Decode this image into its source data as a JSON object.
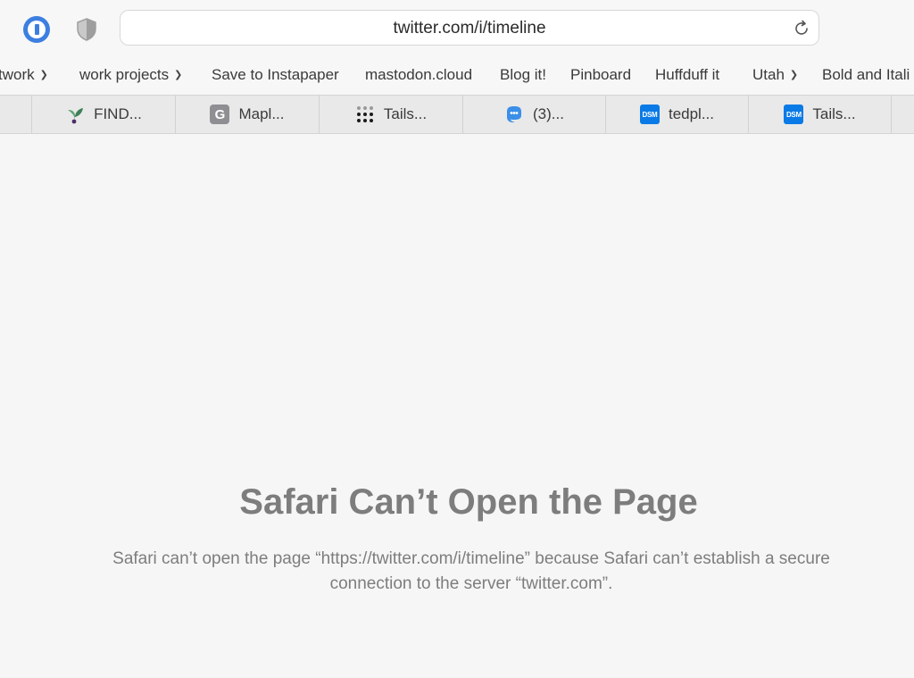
{
  "browser": {
    "url": "twitter.com/i/timeline",
    "extensions": [
      "1password-icon",
      "shield-icon"
    ]
  },
  "bookmarks": [
    {
      "label": "twork",
      "folder": true
    },
    {
      "label": "work projects",
      "folder": true
    },
    {
      "label": "Save to Instapaper",
      "folder": false
    },
    {
      "label": "mastodon.cloud",
      "folder": false
    },
    {
      "label": "Blog it!",
      "folder": false
    },
    {
      "label": "Pinboard",
      "folder": false
    },
    {
      "label": "Huffduff it",
      "folder": false
    },
    {
      "label": "Utah",
      "folder": true
    },
    {
      "label": "Bold and Itali",
      "folder": false
    }
  ],
  "tabs": [
    {
      "title": "FIND...",
      "icon": "sprout-icon"
    },
    {
      "title": "Mapl...",
      "icon": "g-letter-icon",
      "icon_text": "G"
    },
    {
      "title": "Tails...",
      "icon": "dots-grid-icon"
    },
    {
      "title": "(3)...",
      "icon": "mastodon-icon"
    },
    {
      "title": "tedpl...",
      "icon": "dsm-icon",
      "icon_text": "DSM"
    },
    {
      "title": "Tails...",
      "icon": "dsm-icon",
      "icon_text": "DSM"
    }
  ],
  "error": {
    "title": "Safari Can’t Open the Page",
    "message": "Safari can’t open the page “https://twitter.com/i/timeline” because Safari can’t establish a secure connection to the server “twitter.com”."
  },
  "colors": {
    "background": "#f6f6f6",
    "accent_blue": "#3d7fe0",
    "dsm_blue": "#0a7ae6",
    "error_text": "#7d7d7d"
  }
}
